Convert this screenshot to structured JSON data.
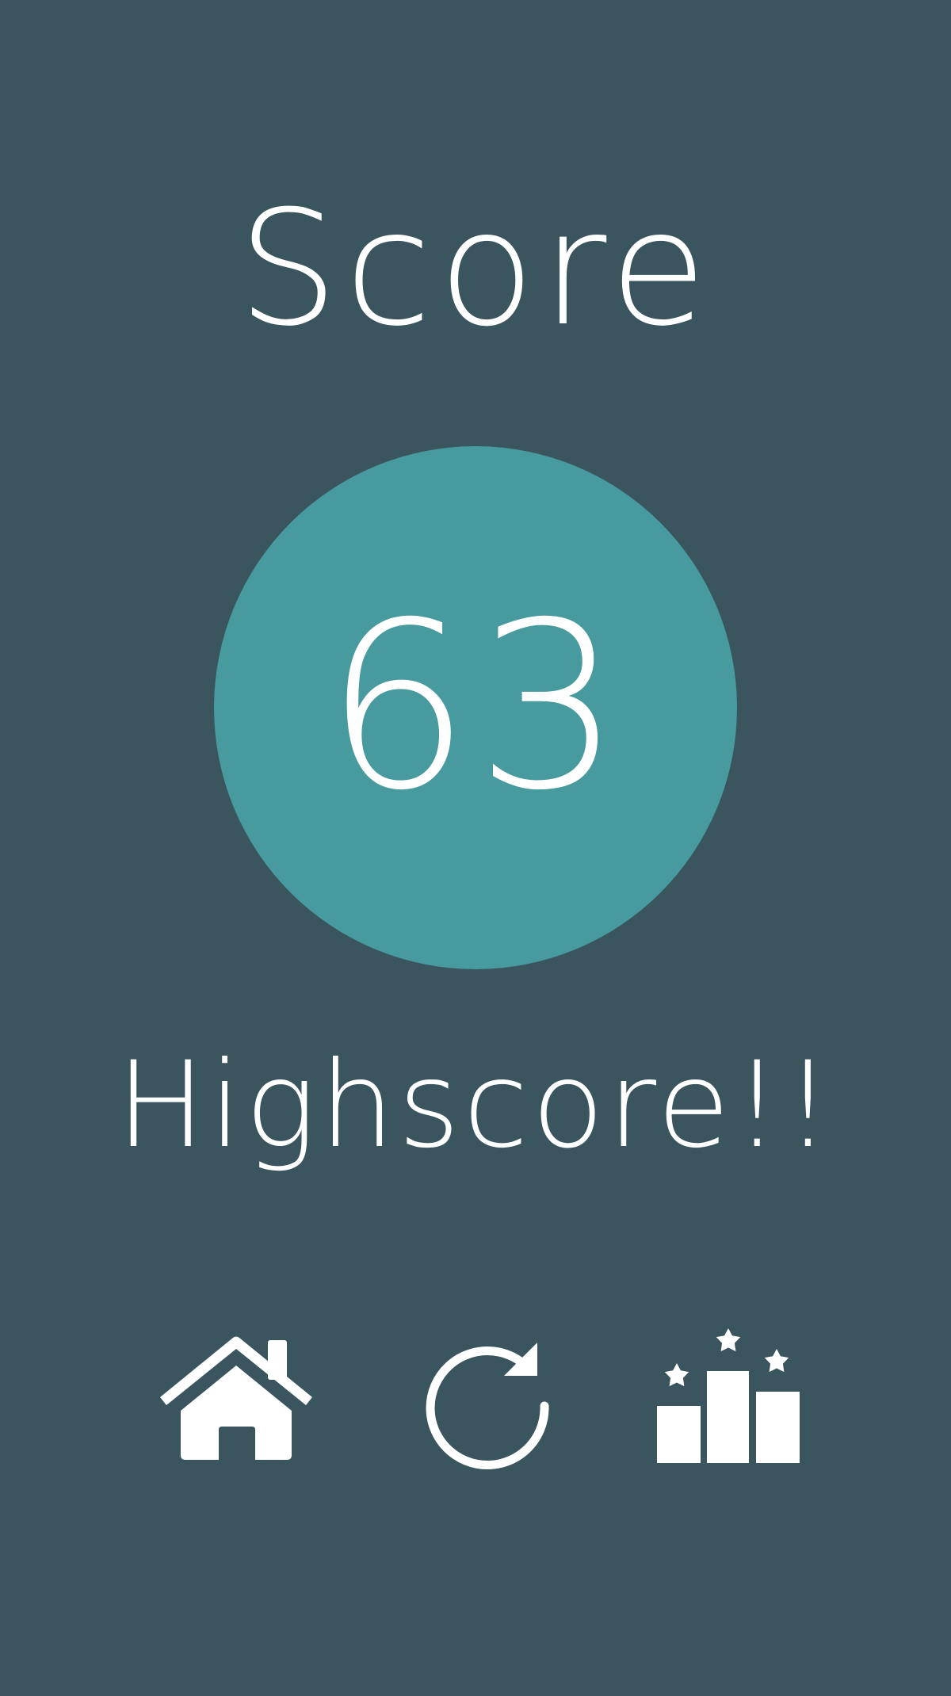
{
  "screen": {
    "title": "Score",
    "score": "63",
    "highscore_label": "Highscore!!"
  },
  "colors": {
    "background": "#3b555f",
    "circle": "#479b9f",
    "foreground": "#ffffff"
  },
  "actions": [
    {
      "icon": "home-icon"
    },
    {
      "icon": "replay-icon"
    },
    {
      "icon": "leaderboard-icon"
    }
  ]
}
